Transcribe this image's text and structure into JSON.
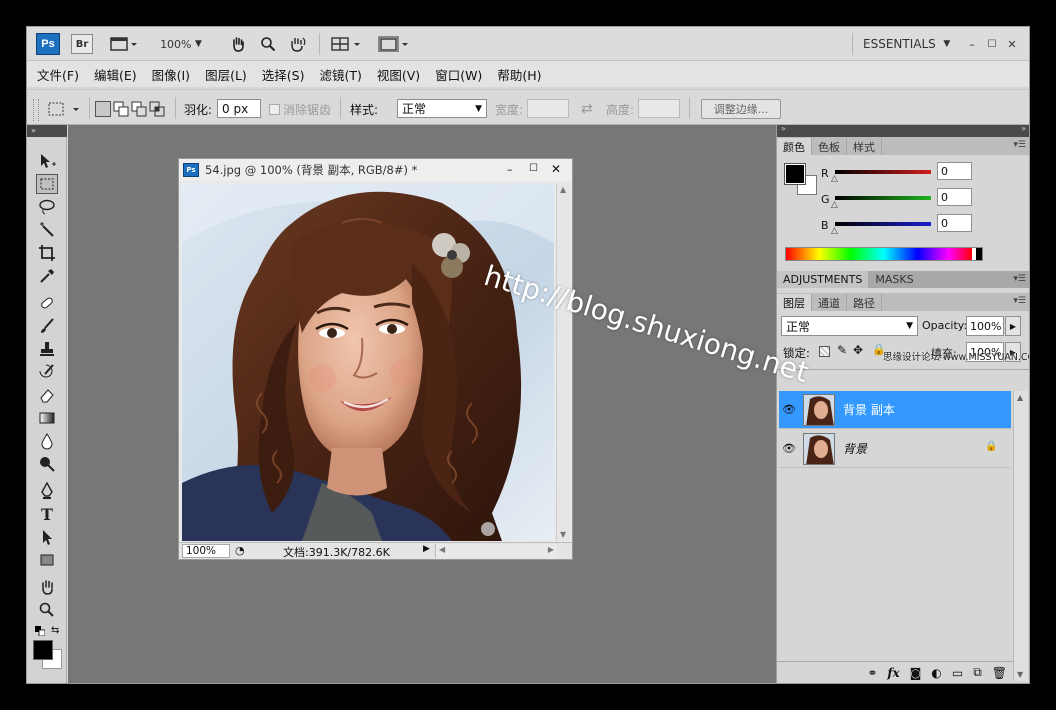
{
  "app": {
    "logo": "Ps",
    "bridge": "Br",
    "zoom": "100%",
    "workspace": "ESSENTIALS",
    "icons": [
      "film-icon",
      "hand-icon",
      "zoom-icon",
      "rotate-view-icon",
      "arrange-icon",
      "screen-mode-icon"
    ]
  },
  "menu": [
    "文件(F)",
    "编辑(E)",
    "图像(I)",
    "图层(L)",
    "选择(S)",
    "滤镜(T)",
    "视图(V)",
    "窗口(W)",
    "帮助(H)"
  ],
  "options": {
    "feather_label": "羽化:",
    "feather_value": "0 px",
    "antialias_label": "消除锯齿",
    "style_label": "样式:",
    "style_value": "正常",
    "width_label": "宽度:",
    "height_label": "高度:",
    "refine_button": "调整边缘..."
  },
  "document": {
    "title": "54.jpg @ 100% (背景 副本, RGB/8#) *",
    "zoom": "100%",
    "doc_info": "文档:391.3K/782.6K"
  },
  "color_panel": {
    "tabs": [
      "颜色",
      "色板",
      "样式"
    ],
    "r_label": "R",
    "g_label": "G",
    "b_label": "B",
    "r": "0",
    "g": "0",
    "b": "0",
    "accent_red": "#d21d1d",
    "accent_green": "#1db51d",
    "accent_blue": "#1d1dd2"
  },
  "adjustments_panel": {
    "tabs": [
      "ADJUSTMENTS",
      "MASKS"
    ]
  },
  "layers_panel": {
    "tabs": [
      "图层",
      "通道",
      "路径"
    ],
    "blend_mode": "正常",
    "opacity_label": "Opacity:",
    "opacity": "100%",
    "lock_label": "锁定:",
    "fill_label": "填充:",
    "fill": "100%",
    "layers": [
      {
        "name": "背景 副本",
        "selected": true
      },
      {
        "name": "背景",
        "selected": false,
        "locked": true
      }
    ],
    "selection_color": "#3399ff"
  },
  "watermark": {
    "url": "http://blog.shuxiong.net",
    "site": "思缘设计论坛 www.MISSYUAN.COM"
  }
}
